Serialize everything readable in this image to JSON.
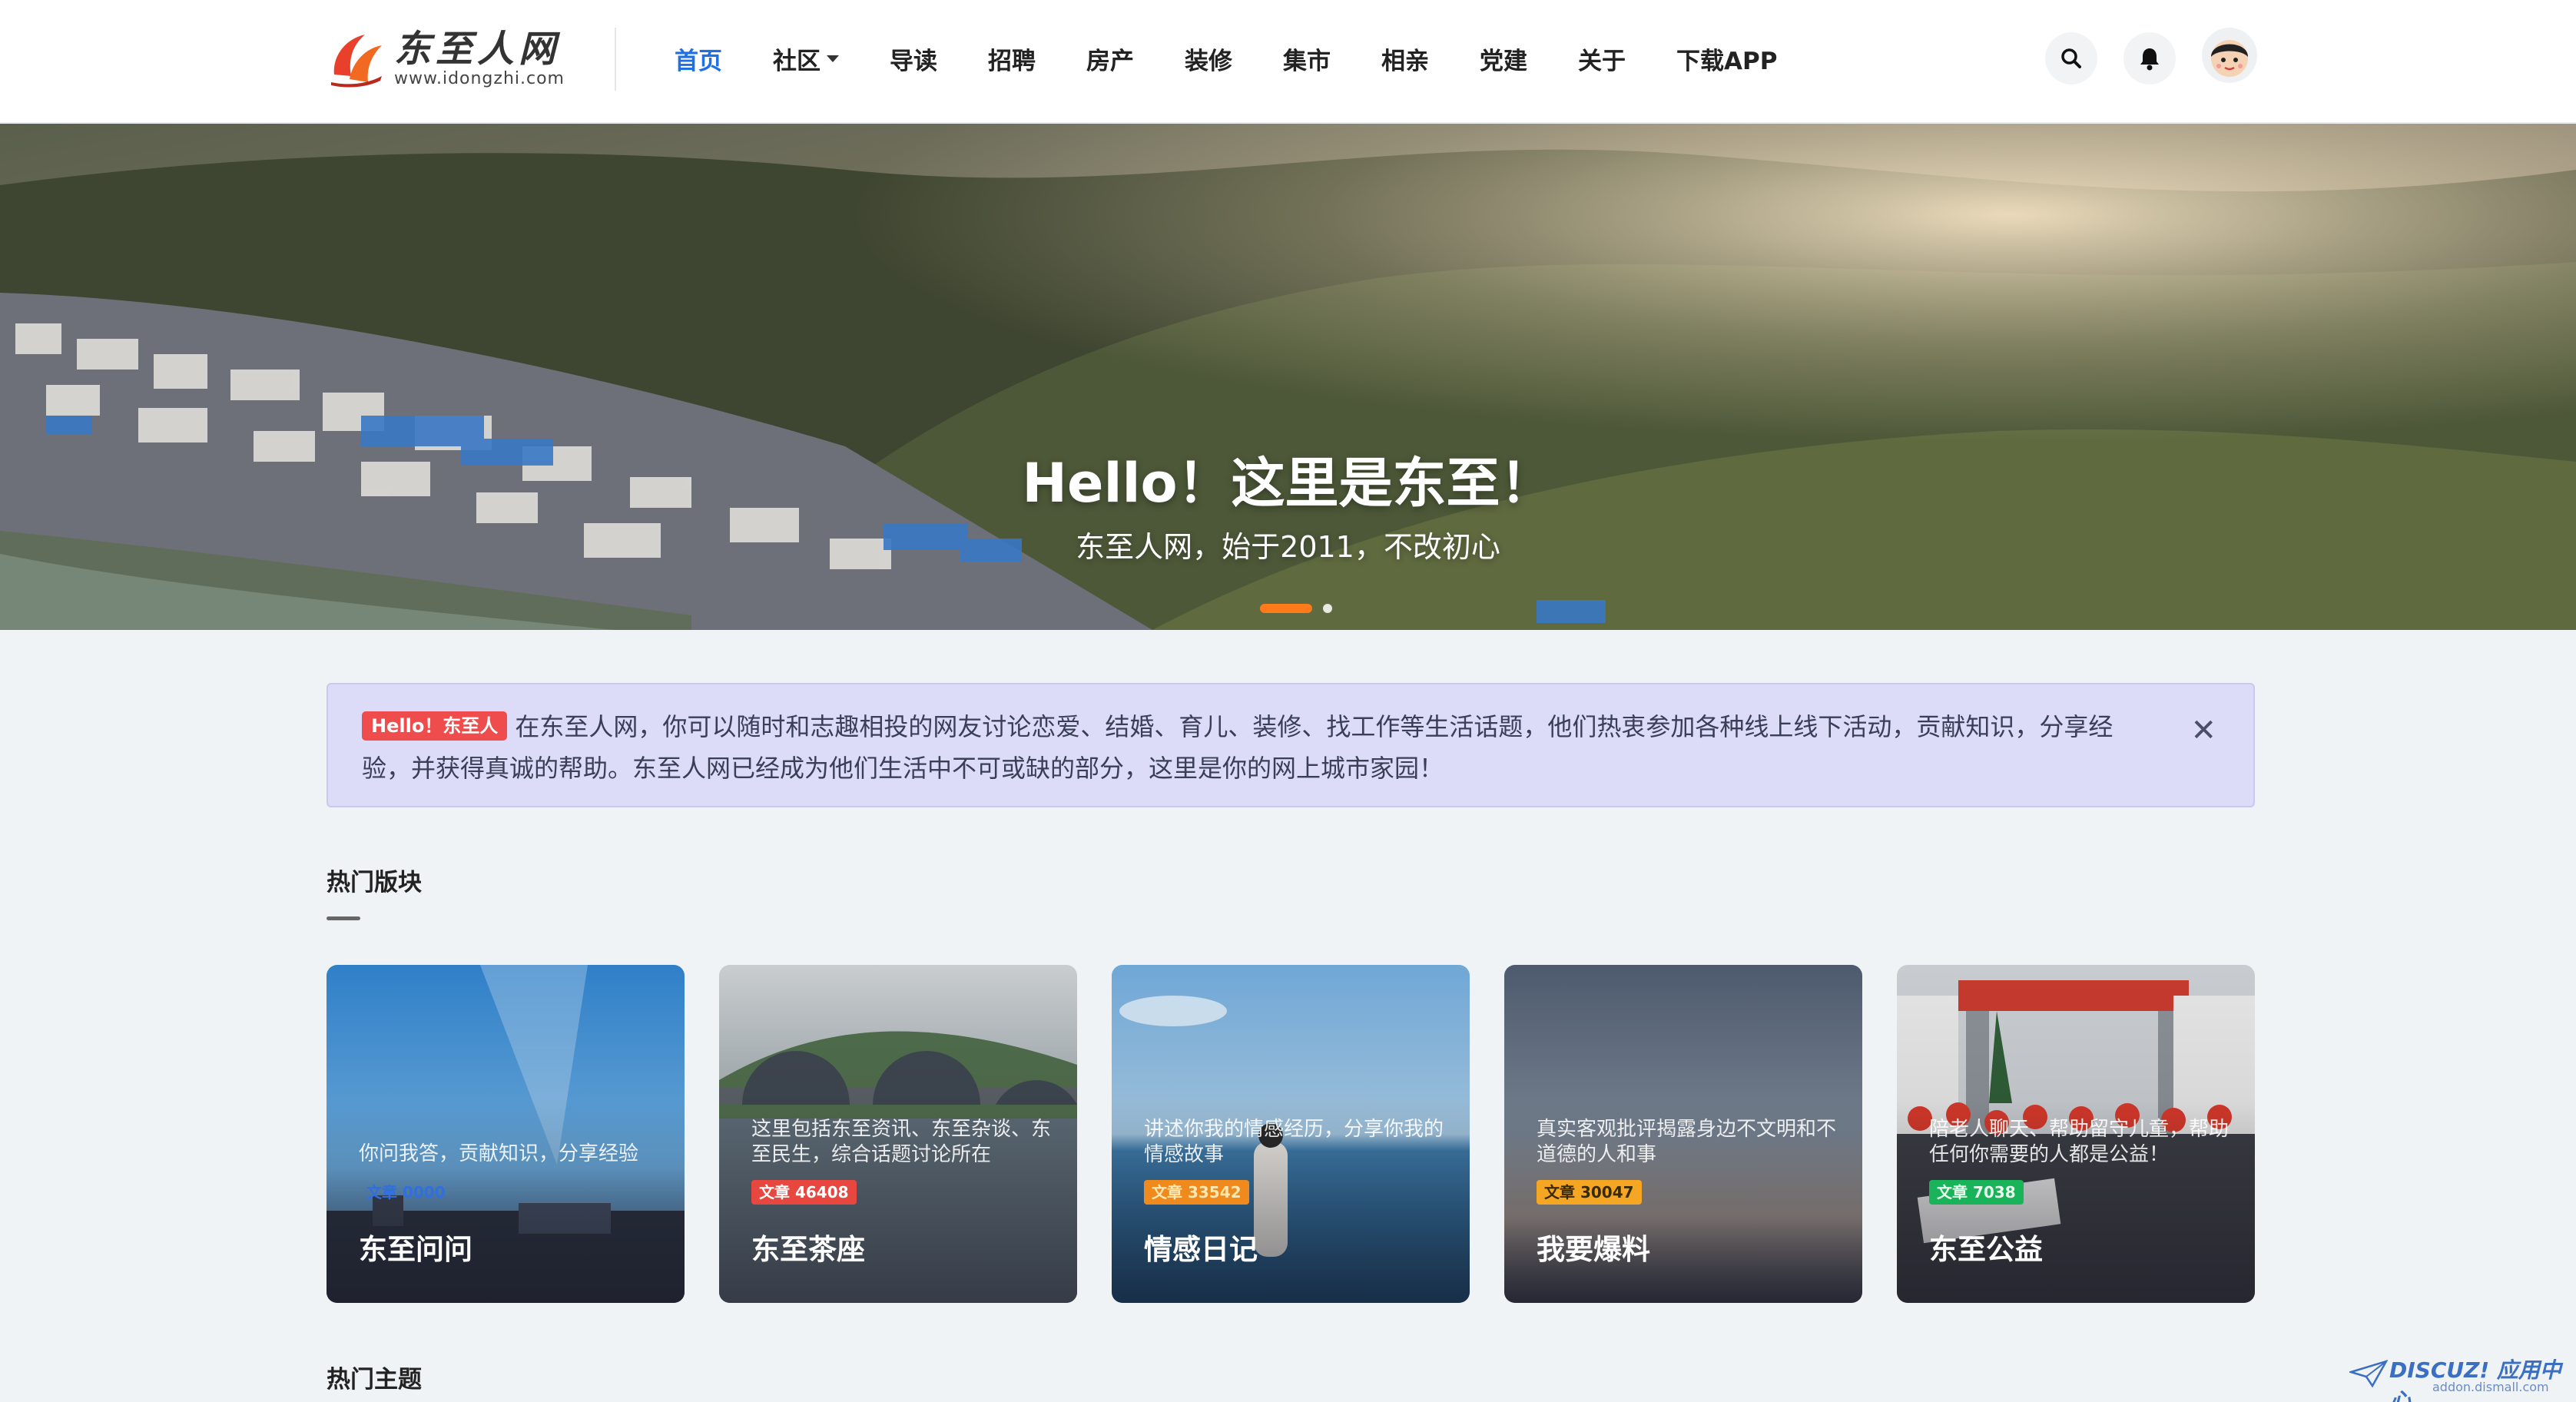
{
  "header": {
    "logo": {
      "cn": "东至人网",
      "url": "www.idongzhi.com"
    },
    "nav": [
      {
        "label": "首页",
        "active": true
      },
      {
        "label": "社区",
        "dropdown": true
      },
      {
        "label": "导读"
      },
      {
        "label": "招聘"
      },
      {
        "label": "房产"
      },
      {
        "label": "装修"
      },
      {
        "label": "集市"
      },
      {
        "label": "相亲"
      },
      {
        "label": "党建"
      },
      {
        "label": "关于"
      },
      {
        "label": "下载APP"
      }
    ],
    "icons": {
      "search": "search-icon",
      "notifications": "bell-icon",
      "avatar": "user-avatar"
    }
  },
  "hero": {
    "title": "Hello！这里是东至！",
    "subtitle": "东至人网，始于2011，不改初心",
    "slides": 2,
    "active_slide": 1
  },
  "notice": {
    "badge": "Hello！东至人",
    "text": "在东至人网，你可以随时和志趣相投的网友讨论恋爱、结婚、育儿、装修、找工作等生活话题，他们热衷参加各种线上线下活动，贡献知识，分享经验，并获得真诚的帮助。东至人网已经成为他们生活中不可或缺的部分，这里是你的网上城市家园！",
    "close_icon": "close-icon"
  },
  "sections": {
    "hot_boards": "热门版块",
    "hot_topics": "热门主题"
  },
  "boards": [
    {
      "name": "东至问问",
      "desc": "你问我答，贡献知识，分享经验",
      "tag": "文章 0000",
      "tag_color": "#2f6fe0",
      "tag_text_color": "#2f6fe0"
    },
    {
      "name": "东至茶座",
      "desc": "这里包括东至资讯、东至杂谈、东至民生，综合话题讨论所在",
      "tag": "文章 46408",
      "tag_color": "#e8473f",
      "tag_text_color": "#ffffff"
    },
    {
      "name": "情感日记",
      "desc": "讲述你我的情感经历，分享你我的情感故事",
      "tag": "文章 33542",
      "tag_color": "#f08a1c",
      "tag_text_color": "#ffe7b0"
    },
    {
      "name": "我要爆料",
      "desc": "真实客观批评揭露身边不文明和不道德的人和事",
      "tag": "文章 30047",
      "tag_color": "#f5a623",
      "tag_text_color": "#3a2a00"
    },
    {
      "name": "东至公益",
      "desc": "陪老人聊天、帮助留守儿童，帮助任何你需要的人都是公益！",
      "tag": "文章 7038",
      "tag_color": "#19b45a",
      "tag_text_color": "#e8ffef"
    }
  ],
  "watermark": {
    "main": "DISCUZ! 应用中心",
    "sub": "addon.dismall.com"
  }
}
